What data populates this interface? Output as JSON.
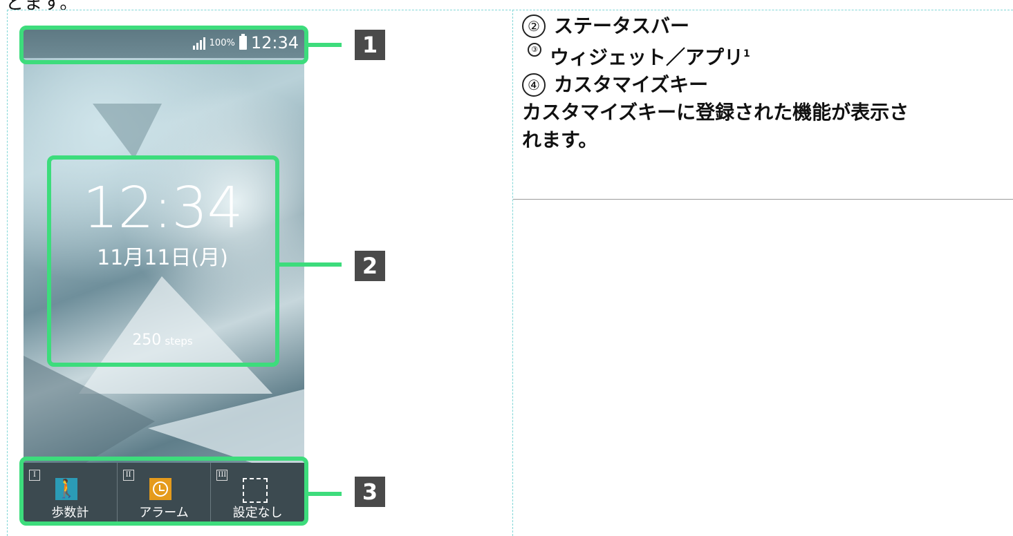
{
  "top_fragment": "とます。",
  "phone": {
    "status": {
      "signal_icon": "signal-icon",
      "battery_percent": "100%",
      "time": "12:34"
    },
    "clock": {
      "time": "12:34",
      "date": "11月11日(月)",
      "steps_value": "250",
      "steps_unit": "steps"
    },
    "keys": [
      {
        "roman": "I",
        "icon": "walk-icon",
        "label": "歩数計"
      },
      {
        "roman": "II",
        "icon": "alarm-icon",
        "label": "アラーム"
      },
      {
        "roman": "III",
        "icon": "empty-slot-icon",
        "label": "設定なし"
      }
    ]
  },
  "callouts": [
    "1",
    "2",
    "3"
  ],
  "description": {
    "item2": {
      "marker": "②",
      "text": "ステータスバー"
    },
    "item3": {
      "marker": "③",
      "text": "ウィジェット／アプリ",
      "sup": "1"
    },
    "item4": {
      "marker": "④",
      "text": "カスタマイズキー"
    },
    "body_line1": "カスタマイズキーに登録された機能が表示さ",
    "body_line2": "れます。"
  },
  "colors": {
    "highlight": "#3ddc7c",
    "badge": "#4a4a4a"
  }
}
